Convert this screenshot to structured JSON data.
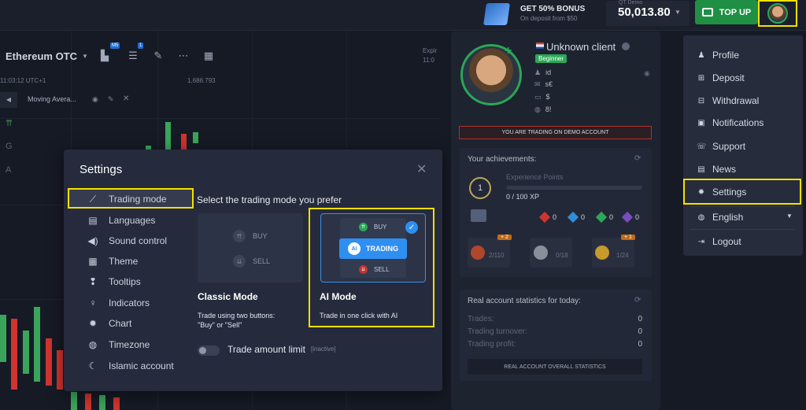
{
  "topbar": {
    "bonus_title": "GET 50% BONUS",
    "bonus_sub": "On deposit from $50",
    "balance_label": "QT Demo",
    "balance_value": "50,013.80",
    "topup_label": "TOP UP"
  },
  "chart": {
    "asset": "Ethereum OTC",
    "badge_ms": "M5",
    "badge_one": "1",
    "time": "11:03:12 UTC+1",
    "price": "1,686.793",
    "indicator": "Moving Avera...",
    "expiration_label": "Expir",
    "expiration_sub": "11:0"
  },
  "settings": {
    "title": "Settings",
    "menu": [
      {
        "label": "Trading mode",
        "icon": "chart-line-icon"
      },
      {
        "label": "Languages",
        "icon": "languages-icon"
      },
      {
        "label": "Sound control",
        "icon": "speaker-icon"
      },
      {
        "label": "Theme",
        "icon": "theme-grid-icon"
      },
      {
        "label": "Tooltips",
        "icon": "tooltip-icon"
      },
      {
        "label": "Indicators",
        "icon": "lightbulb-icon"
      },
      {
        "label": "Chart",
        "icon": "gear-icon"
      },
      {
        "label": "Timezone",
        "icon": "globe-icon"
      },
      {
        "label": "Islamic account",
        "icon": "crescent-icon"
      }
    ],
    "prompt": "Select the trading mode you prefer",
    "classic": {
      "buy": "BUY",
      "sell": "SELL",
      "name": "Classic Mode",
      "desc_line1": "Trade using two buttons:",
      "desc_line2": "\"Buy\" or \"Sell\""
    },
    "ai": {
      "buy": "BUY",
      "trading": "TRADING",
      "badge": "AI",
      "sell": "SELL",
      "name": "AI Mode",
      "desc": "Trade in one click with AI"
    },
    "limit_label": "Trade amount limit",
    "limit_status": "[inactive]"
  },
  "profile": {
    "name": "Unknown client",
    "level": "Beginner",
    "rows": [
      {
        "key": "id",
        "val": ""
      },
      {
        "key": "",
        "val": "s€"
      },
      {
        "key": "",
        "val": "$"
      },
      {
        "key": "",
        "val": "8!"
      }
    ],
    "demo_banner": "YOU ARE TRADING ON DEMO ACCOUNT",
    "achievements_title": "Your achievements:",
    "level_number": "1",
    "xp_label": "Experience Points",
    "xp_value": "0 / 100 XP",
    "gems": [
      "0",
      "0",
      "0",
      "0"
    ],
    "achievement_cards": [
      {
        "count": "2/110",
        "plus": "+ 2"
      },
      {
        "count": "0/18",
        "plus": ""
      },
      {
        "count": "1/24",
        "plus": "+ 1"
      }
    ],
    "stats_title": "Real account statistics for today:",
    "stats": [
      {
        "label": "Trades:",
        "value": "0"
      },
      {
        "label": "Trading turnover:",
        "value": "0"
      },
      {
        "label": "Trading profit:",
        "value": "0"
      }
    ],
    "stats_button": "REAL ACCOUNT OVERALL STATISTICS"
  },
  "dropdown": {
    "items": [
      {
        "label": "Profile",
        "icon": "user-icon"
      },
      {
        "label": "Deposit",
        "icon": "deposit-icon"
      },
      {
        "label": "Withdrawal",
        "icon": "withdrawal-icon"
      },
      {
        "label": "Notifications",
        "icon": "inbox-icon"
      },
      {
        "label": "Support",
        "icon": "support-icon"
      },
      {
        "label": "News",
        "icon": "news-icon"
      },
      {
        "label": "Settings",
        "icon": "gears-icon"
      },
      {
        "label": "English",
        "icon": "globe-icon"
      },
      {
        "label": "Logout",
        "icon": "logout-icon"
      }
    ]
  },
  "colors": {
    "highlight": "#f6e000",
    "accent_green": "#1f8f44",
    "accent_blue": "#2f8ff0",
    "modal_bg": "#252b3c"
  }
}
